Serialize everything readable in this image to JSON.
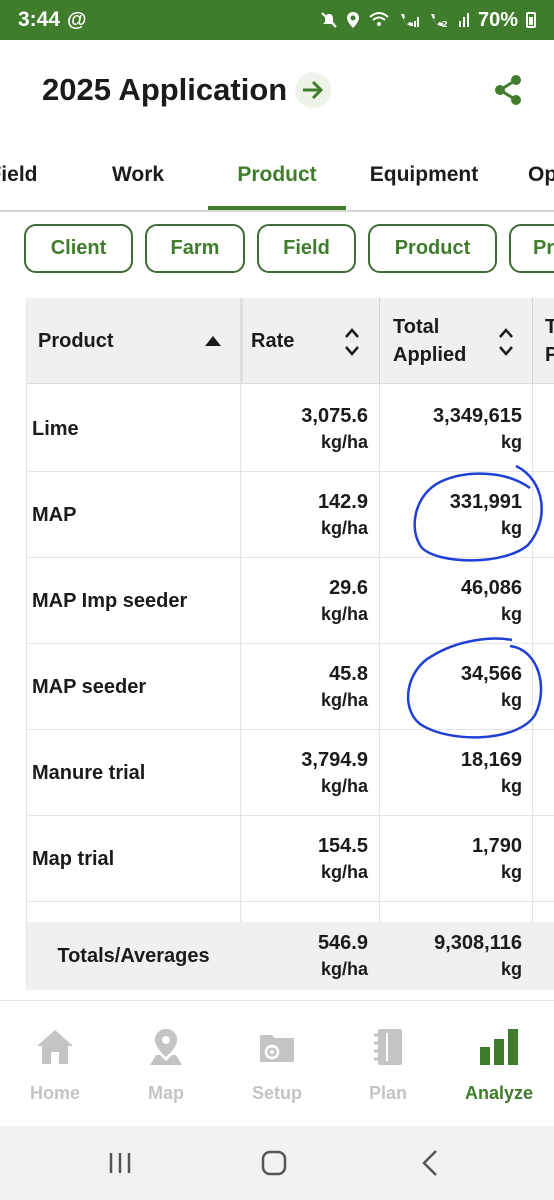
{
  "status_bar": {
    "time": "3:44",
    "at_symbol": "@",
    "battery": "70%",
    "icons": [
      "mute-icon",
      "location-icon",
      "wifi-call-icon",
      "signal-1-icon",
      "wifi-call-2-icon",
      "signal-2-icon",
      "battery-icon"
    ]
  },
  "header": {
    "title": "2025 Application",
    "forward_icon": "arrow-right-icon",
    "share_icon": "share-icon"
  },
  "tabs": [
    {
      "label": "Field"
    },
    {
      "label": "Work"
    },
    {
      "label": "Product",
      "active": true
    },
    {
      "label": "Equipment"
    },
    {
      "label": "Op"
    }
  ],
  "filters": [
    "Client",
    "Farm",
    "Field",
    "Product",
    "Pr"
  ],
  "table": {
    "headers": {
      "product": "Product",
      "rate": "Rate",
      "total_line1": "Total",
      "total_line2": "Applied",
      "next_line1": "T",
      "next_line2": "P"
    },
    "rows": [
      {
        "name": "Lime",
        "rate": "3,075.6",
        "rate_unit": "kg/ha",
        "total": "3,349,615",
        "total_unit": "kg"
      },
      {
        "name": "MAP",
        "rate": "142.9",
        "rate_unit": "kg/ha",
        "total": "331,991",
        "total_unit": "kg"
      },
      {
        "name": "MAP Imp seeder",
        "rate": "29.6",
        "rate_unit": "kg/ha",
        "total": "46,086",
        "total_unit": "kg"
      },
      {
        "name": "MAP seeder",
        "rate": "45.8",
        "rate_unit": "kg/ha",
        "total": "34,566",
        "total_unit": "kg"
      },
      {
        "name": "Manure trial",
        "rate": "3,794.9",
        "rate_unit": "kg/ha",
        "total": "18,169",
        "total_unit": "kg"
      },
      {
        "name": "Map trial",
        "rate": "154.5",
        "rate_unit": "kg/ha",
        "total": "1,790",
        "total_unit": "kg"
      }
    ],
    "totals": {
      "label": "Totals/Averages",
      "rate": "546.9",
      "rate_unit": "kg/ha",
      "total": "9,308,116",
      "total_unit": "kg"
    }
  },
  "bottom_nav": [
    {
      "label": "Home",
      "icon": "home-icon"
    },
    {
      "label": "Map",
      "icon": "map-pin-icon"
    },
    {
      "label": "Setup",
      "icon": "setup-folder-icon"
    },
    {
      "label": "Plan",
      "icon": "plan-notebook-icon"
    },
    {
      "label": "Analyze",
      "icon": "analyze-chart-icon",
      "active": true
    }
  ],
  "colors": {
    "brand_green": "#3f7d2c",
    "annotation_blue": "#1f3fd6",
    "inactive_gray": "#c4c4c4"
  }
}
